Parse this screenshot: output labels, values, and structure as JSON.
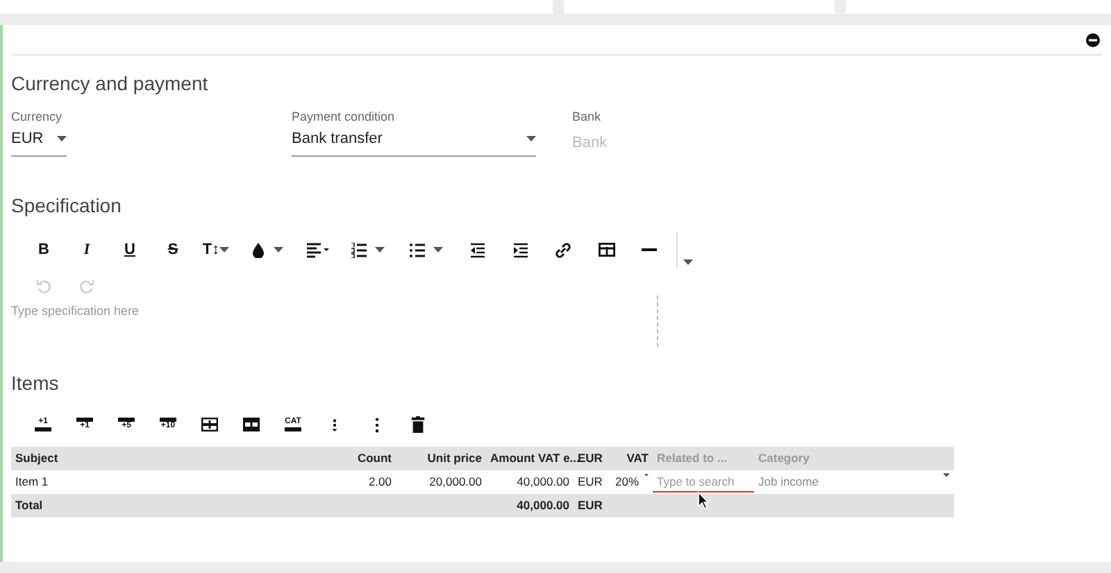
{
  "currency_section": {
    "title": "Currency and payment",
    "fields": [
      {
        "kind": "select",
        "label": "Currency",
        "value": "EUR"
      },
      {
        "kind": "select",
        "label": "Payment condition",
        "value": "Bank transfer"
      },
      {
        "kind": "input",
        "label": "Bank",
        "placeholder": "Bank"
      }
    ]
  },
  "specification": {
    "title": "Specification",
    "format_buttons": [
      "B",
      "I",
      "U",
      "S",
      "T↕"
    ],
    "history_buttons": [
      {
        "disabled": true
      },
      {
        "disabled": true
      }
    ],
    "placeholder": "Type specification here"
  },
  "items": {
    "title": "Items",
    "row_tools": [
      "+1",
      "+1",
      "+5",
      "+10",
      "CAT"
    ],
    "columns": [
      "Subject",
      "Count",
      "Unit price",
      "Amount VAT e...",
      "EUR",
      "VAT",
      "Related to ...",
      "Category"
    ],
    "rows": [
      {
        "subject": "Item 1",
        "count": "2.00",
        "unit_price": "20,000.00",
        "amount": "40,000.00",
        "currency": "EUR",
        "vat": "20%",
        "related_placeholder": "Type to search",
        "category": "Job income"
      }
    ],
    "total": {
      "label": "Total",
      "amount": "40,000.00",
      "currency": "EUR"
    }
  }
}
